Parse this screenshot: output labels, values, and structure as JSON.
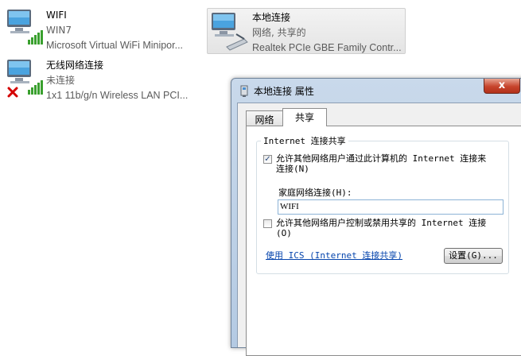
{
  "adapters": [
    {
      "name": "WIFI",
      "status": "WIN7",
      "device": "Microsoft Virtual WiFi Minipor...",
      "icon": "wireless-network-icon",
      "selected": false
    },
    {
      "name": "本地连接",
      "status": "网络, 共享的",
      "device": "Realtek PCIe GBE Family Contr...",
      "icon": "ethernet-network-icon",
      "selected": true
    },
    {
      "name": "无线网络连接",
      "status": "未连接",
      "device": "1x1 11b/g/n Wireless LAN PCI...",
      "icon": "wireless-disconnected-icon",
      "selected": false
    }
  ],
  "dialog": {
    "title": "本地连接 属性",
    "close_symbol": "x",
    "tabs": [
      {
        "label": "网络",
        "active": false
      },
      {
        "label": "共享",
        "active": true
      }
    ],
    "group_title": "Internet 连接共享",
    "allow_share": {
      "checked": true,
      "label": "允许其他网络用户通过此计算机的 Internet 连接来连接(N)"
    },
    "home_network_label": "家庭网络连接(H):",
    "home_network_value": "WIFI",
    "allow_control": {
      "checked": false,
      "label": "允许其他网络用户控制或禁用共享的 Internet 连接(O)"
    },
    "ics_link": "使用 ICS (Internet 连接共享)",
    "settings_button": "设置(G)..."
  },
  "colors": {
    "link": "#0645ad",
    "close_button": "#c7442c",
    "dialog_frame": "#b4cae3",
    "signal_bar": "#3aa02f",
    "error_x": "#d40000"
  }
}
